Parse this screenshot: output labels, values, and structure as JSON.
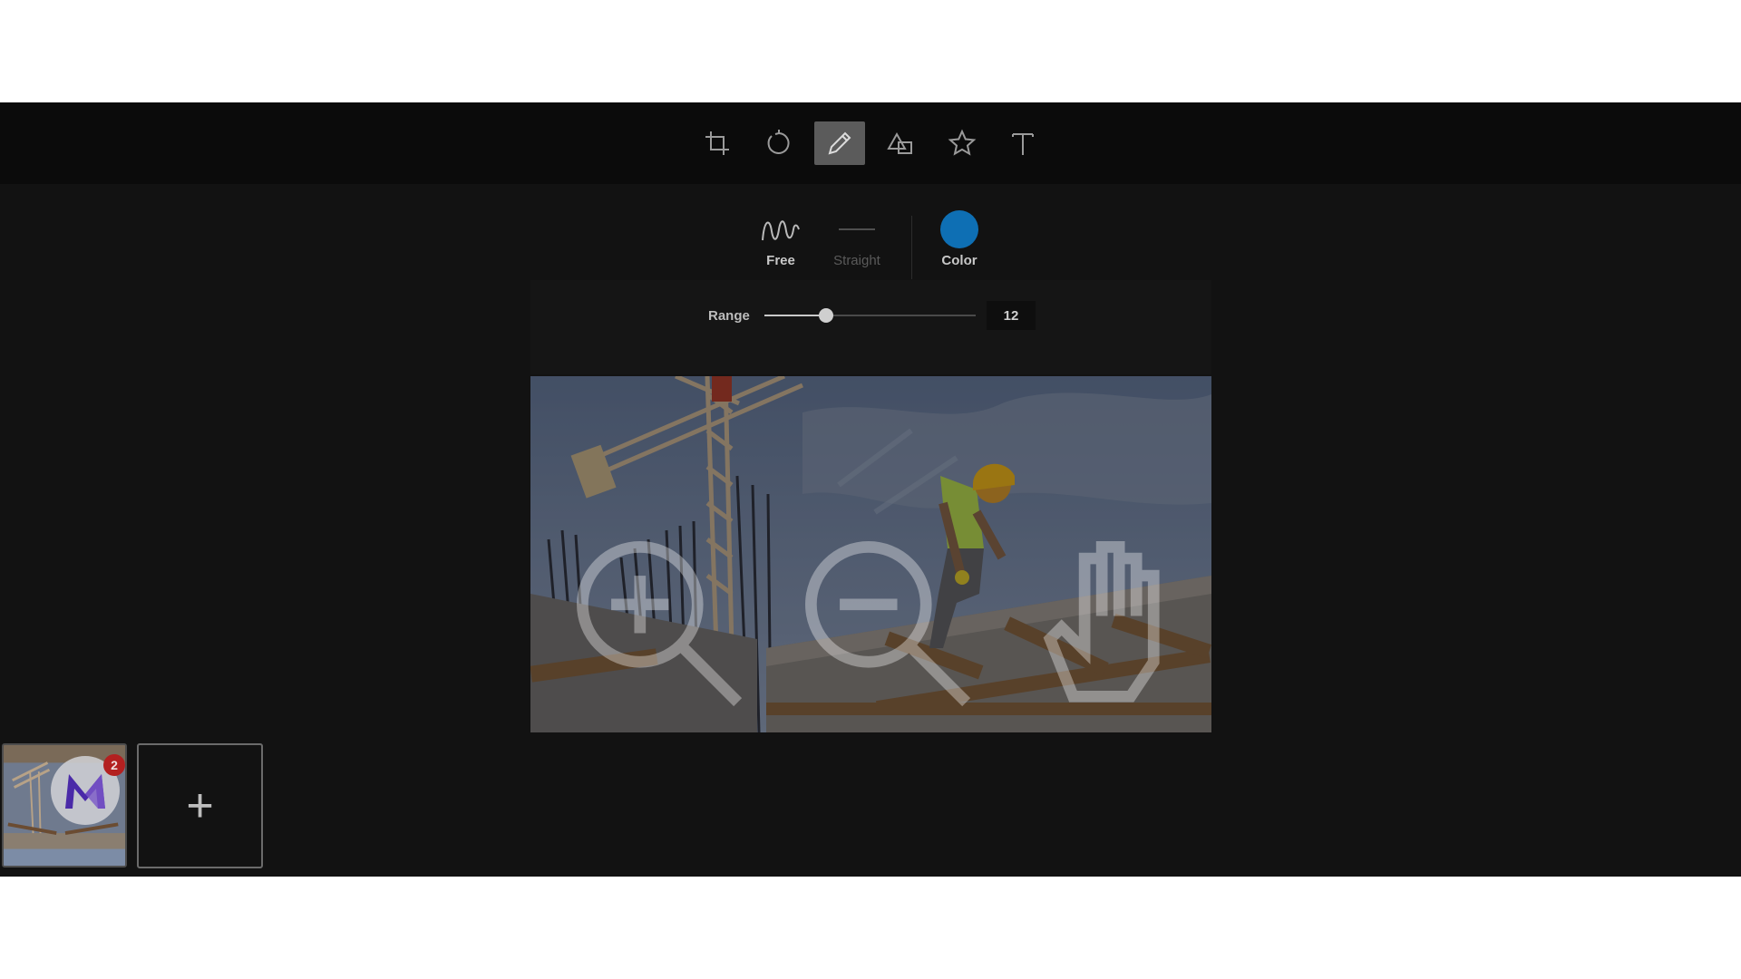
{
  "toolbar": {
    "tools": [
      {
        "name": "crop",
        "icon": "crop-icon",
        "active": false
      },
      {
        "name": "rotate",
        "icon": "rotate-icon",
        "active": false
      },
      {
        "name": "draw",
        "icon": "pencil-icon",
        "active": true
      },
      {
        "name": "shapes",
        "icon": "shapes-icon",
        "active": false
      },
      {
        "name": "sticker",
        "icon": "star-icon",
        "active": false
      },
      {
        "name": "text",
        "icon": "text-icon",
        "active": false
      }
    ]
  },
  "draw_options": {
    "free_label": "Free",
    "straight_label": "Straight",
    "color_label": "Color",
    "selected_mode": "Free",
    "brush_color": "#0e6fb4"
  },
  "range": {
    "label": "Range",
    "value": "12",
    "fraction": 0.29
  },
  "canvas": {
    "zoom_controls": [
      "zoom-in-icon",
      "zoom-out-icon",
      "hand-icon"
    ]
  },
  "thumbnails": {
    "badge_count": "2",
    "add_label": "+"
  }
}
